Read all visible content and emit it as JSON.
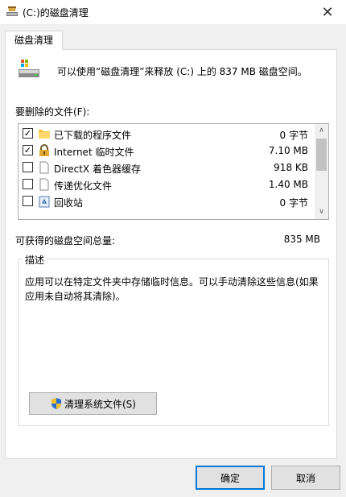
{
  "window": {
    "title": "(C:)的磁盘清理",
    "close_glyph": "✕"
  },
  "tab": {
    "label": "磁盘清理"
  },
  "summary": {
    "text": "可以使用“磁盘清理”来释放 (C:) 上的 837 MB 磁盘空间。"
  },
  "files": {
    "label": "要删除的文件(F):",
    "items": [
      {
        "checked": true,
        "name": "已下载的程序文件",
        "size": "0 字节",
        "icon": "folder-icon"
      },
      {
        "checked": true,
        "name": "Internet 临时文件",
        "size": "7.10 MB",
        "icon": "lock-icon"
      },
      {
        "checked": false,
        "name": "DirectX 着色器缓存",
        "size": "918 KB",
        "icon": "file-icon"
      },
      {
        "checked": false,
        "name": "传递优化文件",
        "size": "1.40 MB",
        "icon": "file-icon"
      },
      {
        "checked": false,
        "name": "回收站",
        "size": "0 字节",
        "icon": "recycle-bin-icon"
      }
    ]
  },
  "total": {
    "label": "可获得的磁盘空间总量:",
    "value": "835 MB"
  },
  "description": {
    "legend": "描述",
    "text": "应用可以在特定文件夹中存储临时信息。可以手动清除这些信息(如果应用未自动将其清除)。"
  },
  "buttons": {
    "cleanup_system": "清理系统文件(S)",
    "ok": "确定",
    "cancel": "取消"
  },
  "check_glyph": "✓",
  "scroll": {
    "up": "∧",
    "down": "∨"
  }
}
